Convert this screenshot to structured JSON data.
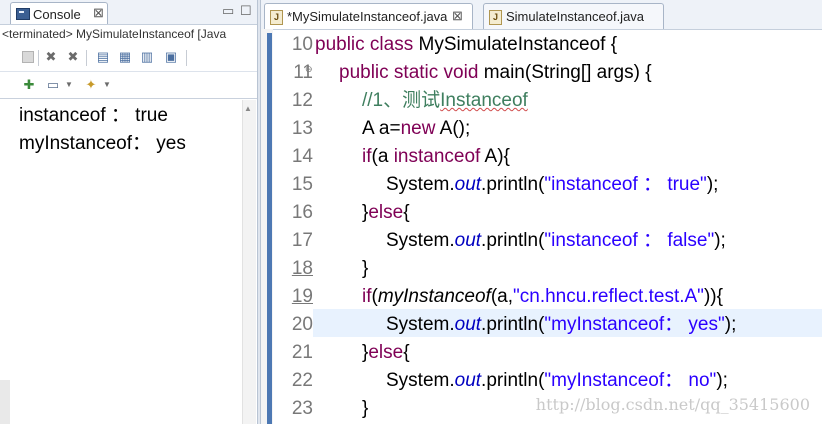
{
  "console": {
    "tab_label": "Console",
    "close_glyph": "⊠",
    "minimize_glyph": "▭",
    "maximize_glyph": "☐",
    "terminated_text": "<terminated> MySimulateInstanceof [Java",
    "output_lines": [
      "instanceof ： true",
      "myInstanceof： yes"
    ]
  },
  "editor": {
    "tabs": [
      {
        "label": "*MySimulateInstanceof.java",
        "active": true
      },
      {
        "label": "SimulateInstanceof.java",
        "active": false
      }
    ],
    "line_numbers": [
      "10",
      "11",
      "12",
      "13",
      "14",
      "15",
      "16",
      "17",
      "18",
      "19",
      "20",
      "21",
      "22",
      "23"
    ],
    "code": {
      "l10": {
        "kw": "public class ",
        "rest": "MySimulateInstanceof {"
      },
      "l11": {
        "kw": "public static void ",
        "rest": "main(String[] args) {"
      },
      "l12": {
        "comment_a": "//1、测试",
        "comment_b": "Instanceof"
      },
      "l13": {
        "a": "A a=",
        "kw": "new",
        "b": " A();"
      },
      "l14": {
        "kw_if": "if",
        "a": "(a ",
        "kw_inst": "instanceof",
        "b": " A){"
      },
      "l15": {
        "a": "System.",
        "field": "out",
        "b": ".println(",
        "str": "\"instanceof ： true\"",
        "c": ");"
      },
      "l16": {
        "a": "}",
        "kw": "else",
        "b": "{"
      },
      "l17": {
        "a": "System.",
        "field": "out",
        "b": ".println(",
        "str": "\"instanceof ： false\"",
        "c": ");"
      },
      "l18": {
        "a": "}"
      },
      "l19": {
        "kw": "if",
        "a": "(",
        "method": "myInstanceof",
        "b": "(a,",
        "str": "\"cn.hncu.reflect.test.A\"",
        "c": ")){"
      },
      "l20": {
        "a": "System.",
        "field": "out",
        "b": ".println(",
        "str": "\"myInstanceof： yes\"",
        "c": ");"
      },
      "l21": {
        "a": "}",
        "kw": "else",
        "b": "{"
      },
      "l22": {
        "a": "System.",
        "field": "out",
        "b": ".println(",
        "str": "\"myInstanceof： no\"",
        "c": ");"
      },
      "l23": {
        "a": "}"
      }
    }
  },
  "watermark": "http://blog.csdn.net/qq_35415600",
  "colors": {
    "keyword": "#7f0055",
    "string": "#2a00ff",
    "comment": "#3f7f5f",
    "field": "#0000c0",
    "current_line": "#e8f2fe"
  }
}
